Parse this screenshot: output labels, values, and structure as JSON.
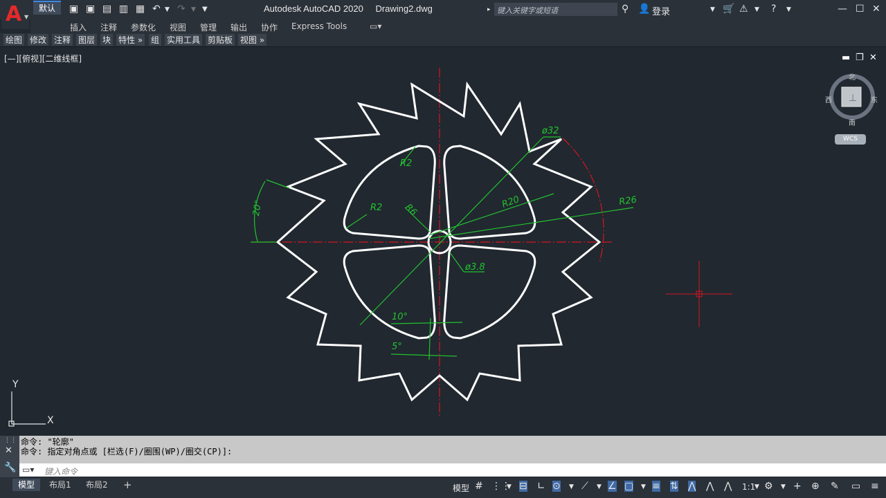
{
  "app": {
    "title": "Autodesk AutoCAD 2020",
    "filename": "Drawing2.dwg",
    "search_placeholder": "键入关键字或短语",
    "login_label": "登录"
  },
  "ribbon_tabs": [
    "默认",
    "插入",
    "注释",
    "参数化",
    "视图",
    "管理",
    "输出",
    "协作",
    "Express Tools"
  ],
  "panels": [
    "绘图",
    "修改",
    "注释",
    "图层",
    "块",
    "特性",
    "组",
    "实用工具",
    "剪贴板",
    "视图"
  ],
  "viewport_label": "[—][俯视][二维线框]",
  "viewcube": {
    "north": "北",
    "south": "南",
    "east": "东",
    "west": "西",
    "wcs": "WCS"
  },
  "dimensions": {
    "d_outer": "ø32",
    "r20": "R20",
    "r26": "R26",
    "r2a": "R2",
    "r2b": "R2",
    "r6": "R6",
    "d_inner": "ø3.8",
    "ang20": "20°",
    "ang10": "10°",
    "ang5": "5°"
  },
  "ucs": {
    "y": "Y",
    "x": "X"
  },
  "command": {
    "line1": "命令:  \"轮廓\"",
    "line2": "命令: 指定对角点或 [栏选(F)/圈围(WP)/圈交(CP)]:",
    "placeholder": "键入命令"
  },
  "layout_tabs": [
    "模型",
    "布局1",
    "布局2"
  ],
  "status": {
    "model": "模型",
    "scale": "1:1"
  },
  "colors": {
    "background": "#212830",
    "geometry": "#ffffff",
    "dimension": "#22c32e",
    "centerline": "#d7161f",
    "accent": "#3b8be8"
  }
}
